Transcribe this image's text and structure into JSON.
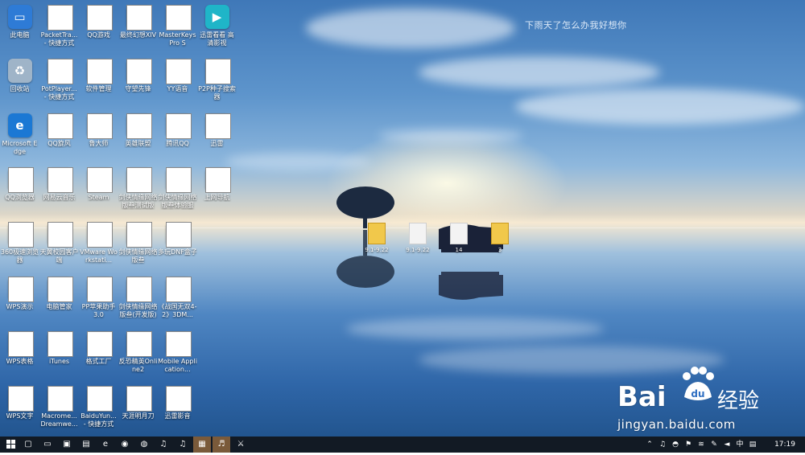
{
  "desktop": {
    "corner_text": "下雨天了怎么办我好想你",
    "icons": [
      {
        "label": "此电脑",
        "icon": "computer-icon",
        "color": "#2e7bd6",
        "glyph": "▭",
        "shortcut": false
      },
      {
        "label": "PacketTra... - 快捷方式",
        "icon": "packet-tracer-icon",
        "color": "#3b6e2f",
        "glyph": "✉",
        "shortcut": true
      },
      {
        "label": "QQ游戏",
        "icon": "qq-game-icon",
        "color": "#f2a20d",
        "glyph": "◕",
        "shortcut": true
      },
      {
        "label": "最终幻想XIV",
        "icon": "ffxiv-icon",
        "color": "#2d3f66",
        "glyph": "✦",
        "shortcut": true
      },
      {
        "label": "MasterKeys Pro S",
        "icon": "coolermaster-icon",
        "color": "#1c1c1c",
        "glyph": "CM",
        "shortcut": true
      },
      {
        "label": "迅雷看看 高清影视",
        "icon": "xunlei-kankan-icon",
        "color": "#1fb5c8",
        "glyph": "▶",
        "shortcut": false
      },
      {
        "label": "回收站",
        "icon": "recycle-bin-icon",
        "color": "#9fb4c8",
        "glyph": "♻",
        "shortcut": false
      },
      {
        "label": "PotPlayer... - 快捷方式",
        "icon": "potplayer-icon",
        "color": "#6a3fd8",
        "glyph": "▶",
        "shortcut": true
      },
      {
        "label": "软件管理",
        "icon": "software-manager-icon",
        "color": "#32b34a",
        "glyph": "✿",
        "shortcut": true
      },
      {
        "label": "守望先锋",
        "icon": "overwatch-icon",
        "color": "#f19a1e",
        "glyph": "◎",
        "shortcut": true
      },
      {
        "label": "YY语音",
        "icon": "yy-voice-icon",
        "color": "#f7c51e",
        "glyph": "☺",
        "shortcut": true
      },
      {
        "label": "P2P种子搜索器",
        "icon": "p2p-search-icon",
        "color": "#2a8fe0",
        "glyph": "⌕",
        "shortcut": true
      },
      {
        "label": "Microsoft Edge",
        "icon": "edge-icon",
        "color": "#1b78d4",
        "glyph": "e",
        "shortcut": false
      },
      {
        "label": "QQ旋风",
        "icon": "qq-xuanfeng-icon",
        "color": "#2fb55a",
        "glyph": "↻",
        "shortcut": true
      },
      {
        "label": "鲁大师",
        "icon": "ludashi-icon",
        "color": "#2a3d7a",
        "glyph": "☻",
        "shortcut": true
      },
      {
        "label": "英雄联盟",
        "icon": "lol-icon",
        "color": "#2d2b1e",
        "glyph": "L",
        "shortcut": true
      },
      {
        "label": "腾讯QQ",
        "icon": "qq-icon",
        "color": "#1f1f1f",
        "glyph": "◓",
        "shortcut": true
      },
      {
        "label": "迅雷",
        "icon": "thunder-icon",
        "color": "#2a8ff0",
        "glyph": "➤",
        "shortcut": true
      },
      {
        "label": "QQ浏览器",
        "icon": "qq-browser-icon",
        "color": "#33a3f2",
        "glyph": "◉",
        "shortcut": true
      },
      {
        "label": "网易云音乐",
        "icon": "netease-music-icon",
        "color": "#e02424",
        "glyph": "♫",
        "shortcut": true
      },
      {
        "label": "Steam",
        "icon": "steam-icon",
        "color": "#1b2838",
        "glyph": "⚙",
        "shortcut": true
      },
      {
        "label": "剑侠情缘网络版叁测试版",
        "icon": "jx3-test-icon",
        "color": "#c2381a",
        "glyph": "⚔",
        "shortcut": true
      },
      {
        "label": "剑侠情缘网络版叁体验服",
        "icon": "jx3-exp-icon",
        "color": "#e07a14",
        "glyph": "⚔",
        "shortcut": true
      },
      {
        "label": "上网导航",
        "icon": "ie-nav-icon",
        "color": "#1c7fe0",
        "glyph": "e",
        "shortcut": true
      },
      {
        "label": "360极速浏览器",
        "icon": "360-browser-icon",
        "color": "#e24a86",
        "glyph": "❂",
        "shortcut": true
      },
      {
        "label": "天翼校园客户端",
        "icon": "tianyi-icon",
        "color": "#f0a020",
        "glyph": "✪",
        "shortcut": true
      },
      {
        "label": "VMware Workstati...",
        "icon": "vmware-icon",
        "color": "#2e6fb4",
        "glyph": "▣",
        "shortcut": true
      },
      {
        "label": "剑侠情缘网络版叁",
        "icon": "jx3-icon",
        "color": "#c2381a",
        "glyph": "⚔",
        "shortcut": true
      },
      {
        "label": "多玩DNF盒子",
        "icon": "dnf-box-icon",
        "color": "#3a3a3a",
        "glyph": "◆",
        "shortcut": true
      },
      {
        "label": "WPS演示",
        "icon": "wps-presentation-icon",
        "color": "#ef6a1a",
        "glyph": "P",
        "shortcut": true
      },
      {
        "label": "电脑管家",
        "icon": "pc-manager-icon",
        "color": "#1e74d8",
        "glyph": "✓",
        "shortcut": true
      },
      {
        "label": "PP苹果助手3.0",
        "icon": "pp-assistant-icon",
        "color": "#2370e6",
        "glyph": "P",
        "shortcut": true
      },
      {
        "label": "剑侠情缘网络版叁(开发版)",
        "icon": "jx3-dev-icon",
        "color": "#3569c0",
        "glyph": "⚔",
        "shortcut": true
      },
      {
        "label": "《战国无双4-2》3DM...",
        "icon": "warriors-icon",
        "color": "#8a2a8a",
        "glyph": "☠",
        "shortcut": true
      },
      {
        "label": "WPS表格",
        "icon": "wps-spreadsheet-icon",
        "color": "#23a648",
        "glyph": "S",
        "shortcut": true
      },
      {
        "label": "iTunes",
        "icon": "itunes-icon",
        "color": "#f2f2f2",
        "glyph": "♪",
        "shortcut": true
      },
      {
        "label": "格式工厂",
        "icon": "format-factory-icon",
        "color": "#6f7d8e",
        "glyph": "⚒",
        "shortcut": true
      },
      {
        "label": "反恐精英Online2",
        "icon": "csol2-icon",
        "color": "#2b2b2b",
        "glyph": "✚",
        "shortcut": true
      },
      {
        "label": "Mobile Application...",
        "icon": "mobile-app-icon",
        "color": "#e8d9a8",
        "glyph": "▤",
        "shortcut": true
      },
      {
        "label": "WPS文字",
        "icon": "wps-writer-icon",
        "color": "#2a6fd8",
        "glyph": "W",
        "shortcut": true
      },
      {
        "label": "Macrome... Dreamwe...",
        "icon": "dreamweaver-icon",
        "color": "#2f9f3a",
        "glyph": "♪",
        "shortcut": true
      },
      {
        "label": "BaiduYun... - 快捷方式",
        "icon": "baiduyun-icon",
        "color": "#2f82e0",
        "glyph": "☁",
        "shortcut": true
      },
      {
        "label": "天涯明月刀",
        "icon": "tianya-icon",
        "color": "#d8d8d8",
        "glyph": "✒",
        "shortcut": true
      },
      {
        "label": "迅雷影音",
        "icon": "xunlei-player-icon",
        "color": "#1f8ff0",
        "glyph": "▶",
        "shortcut": true
      }
    ],
    "center_files": [
      {
        "label": "9.1-9.22",
        "icon": "folder-icon",
        "color": "yellow"
      },
      {
        "label": "9.1-9.22",
        "icon": "text-file-icon",
        "color": "white"
      },
      {
        "label": "14",
        "icon": "text-file-icon",
        "color": "white"
      },
      {
        "label": "3",
        "icon": "folder-icon",
        "color": "yellow"
      }
    ]
  },
  "watermark": {
    "brand_left": "Bai",
    "brand_right": "经验",
    "brand_paw": "du",
    "url": "jingyan.baidu.com"
  },
  "taskbar": {
    "start_icon": "windows-start-icon",
    "pinned": [
      {
        "icon": "task-view-icon",
        "glyph": "▢"
      },
      {
        "icon": "this-pc-icon",
        "glyph": "▭"
      },
      {
        "icon": "store-icon",
        "glyph": "▣"
      },
      {
        "icon": "file-explorer-icon",
        "glyph": "▤"
      },
      {
        "icon": "edge-taskbar-icon",
        "glyph": "e"
      },
      {
        "icon": "qq-browser-taskbar-icon",
        "glyph": "◉"
      },
      {
        "icon": "chrome-taskbar-icon",
        "glyph": "◍"
      },
      {
        "icon": "netease-taskbar-icon",
        "glyph": "♫"
      },
      {
        "icon": "netease-taskbar-2-icon",
        "glyph": "♫"
      },
      {
        "icon": "image-viewer-taskbar-icon",
        "glyph": "▦",
        "active": true
      },
      {
        "icon": "music-taskbar-icon",
        "glyph": "♬",
        "active": true
      },
      {
        "icon": "jx3-taskbar-icon",
        "glyph": "⚔"
      }
    ],
    "tray": [
      {
        "icon": "chevron-up-icon",
        "glyph": "⌃"
      },
      {
        "icon": "qq-music-tray-icon",
        "glyph": "♫"
      },
      {
        "icon": "qq-tray-icon",
        "glyph": "◓"
      },
      {
        "icon": "vpn-tray-icon",
        "glyph": "⚑"
      },
      {
        "icon": "wifi-tray-icon",
        "glyph": "≋"
      },
      {
        "icon": "input-tray-icon",
        "glyph": "✎"
      },
      {
        "icon": "volume-tray-icon",
        "glyph": "◄"
      },
      {
        "icon": "ime-label",
        "glyph": "中"
      },
      {
        "icon": "notification-icon",
        "glyph": "▤"
      }
    ],
    "clock": "17:19"
  }
}
